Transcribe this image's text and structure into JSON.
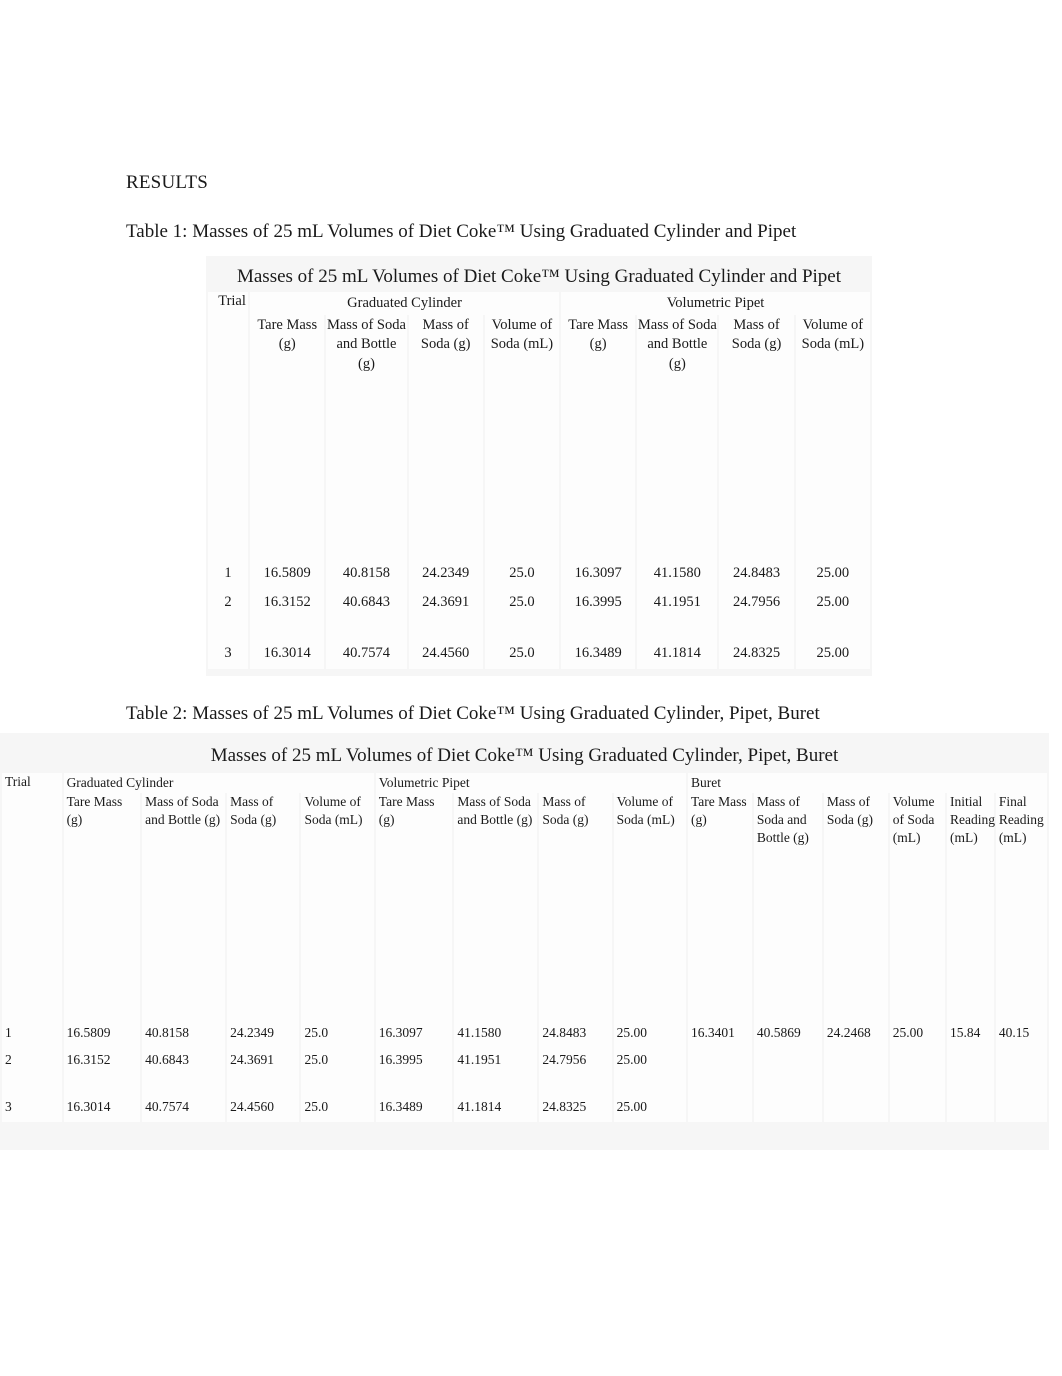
{
  "document": {
    "section_heading": "RESULTS",
    "caption_1": "Table 1: Masses of 25 mL Volumes of Diet Coke™ Using Graduated Cylinder and Pipet",
    "caption_2": "Table 2: Masses of 25 mL Volumes of Diet Coke™ Using Graduated Cylinder, Pipet, Buret"
  },
  "table1": {
    "title": "Masses of 25 mL Volumes of Diet Coke™ Using Graduated Cylinder and Pipet",
    "trial_header": "Trial",
    "groups": [
      {
        "label": "Graduated Cylinder",
        "span": 4
      },
      {
        "label": "Volumetric Pipet",
        "span": 4
      }
    ],
    "columns": [
      "Tare Mass (g)",
      "Mass of Soda and Bottle (g)",
      "Mass of Soda (g)",
      "Volume of Soda (mL)",
      "Tare Mass (g)",
      "Mass of Soda and Bottle (g)",
      "Mass of Soda (g)",
      "Volume of Soda (mL)"
    ],
    "rows": [
      {
        "trial": "1",
        "values": [
          "16.5809",
          "40.8158",
          "24.2349",
          "25.0",
          "16.3097",
          "41.1580",
          "24.8483",
          "25.00"
        ]
      },
      {
        "trial": "2",
        "values": [
          "16.3152",
          "40.6843",
          "24.3691",
          "25.0",
          "16.3995",
          "41.1951",
          "24.7956",
          "25.00"
        ]
      },
      {
        "trial": "3",
        "values": [
          "16.3014",
          "40.7574",
          "24.4560",
          "25.0",
          "16.3489",
          "41.1814",
          "24.8325",
          "25.00"
        ]
      }
    ]
  },
  "table2": {
    "title": "Masses of 25 mL Volumes of Diet Coke™ Using Graduated Cylinder, Pipet, Buret",
    "trial_header": "Trial",
    "groups": [
      {
        "label": "Graduated Cylinder",
        "span": 4
      },
      {
        "label": "Volumetric Pipet",
        "span": 4
      },
      {
        "label": "Buret",
        "span": 6
      }
    ],
    "columns": [
      "Tare Mass (g)",
      "Mass of Soda and Bottle (g)",
      "Mass of Soda (g)",
      "Volume of Soda (mL)",
      "Tare Mass (g)",
      "Mass of Soda and Bottle (g)",
      "Mass of Soda (g)",
      "Volume of Soda (mL)",
      "Tare Mass (g)",
      "Mass of Soda and Bottle (g)",
      "Mass of Soda (g)",
      "Volume of Soda (mL)",
      "Initial Reading (mL)",
      "Final Reading (mL)"
    ],
    "rows": [
      {
        "trial": "1",
        "values": [
          "16.5809",
          "40.8158",
          "24.2349",
          "25.0",
          "16.3097",
          "41.1580",
          "24.8483",
          "25.00",
          "16.3401",
          "40.5869",
          "24.2468",
          "25.00",
          "15.84",
          "40.15"
        ]
      },
      {
        "trial": "2",
        "values": [
          "16.3152",
          "40.6843",
          "24.3691",
          "25.0",
          "16.3995",
          "41.1951",
          "24.7956",
          "25.00",
          "",
          "",
          "",
          "",
          "",
          ""
        ]
      },
      {
        "trial": "3",
        "values": [
          "16.3014",
          "40.7574",
          "24.4560",
          "25.0",
          "16.3489",
          "41.1814",
          "24.8325",
          "25.00",
          "",
          "",
          "",
          "",
          "",
          ""
        ]
      }
    ]
  }
}
